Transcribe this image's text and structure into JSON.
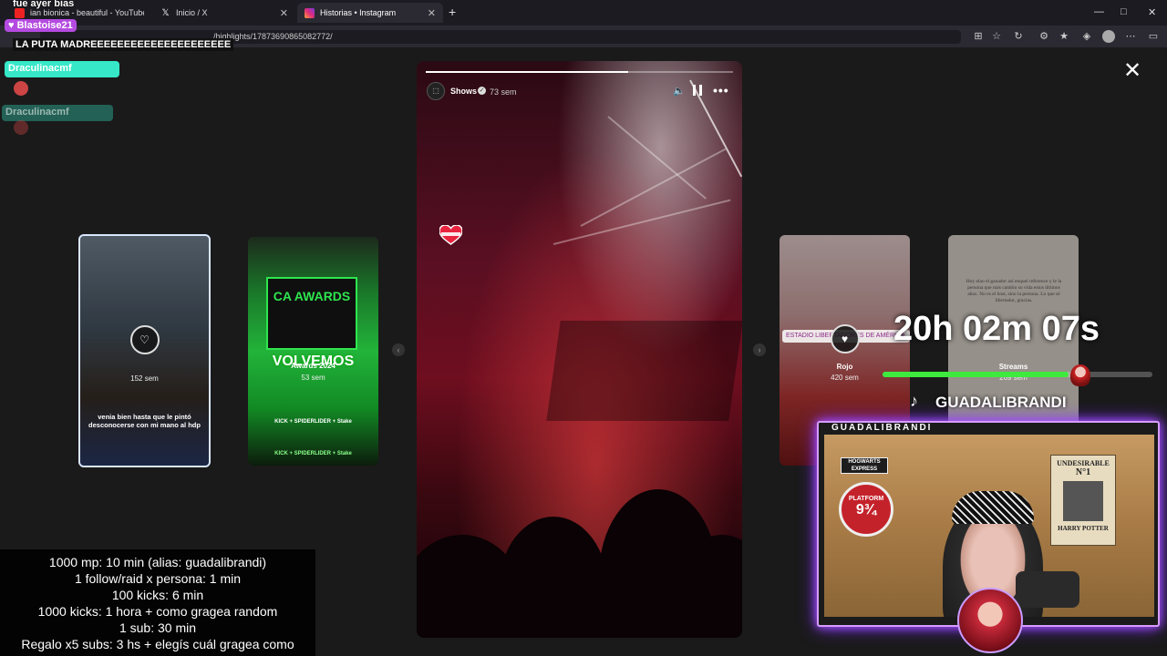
{
  "browser": {
    "tabs": [
      {
        "title": "ian bionica - beautiful - YouTube",
        "active": false,
        "icon": "youtube-icon"
      },
      {
        "title": "Inicio / X",
        "active": false,
        "icon": "x-icon"
      },
      {
        "title": "Historias • Instagram",
        "active": true,
        "icon": "instagram-icon"
      }
    ],
    "new_tab": "+",
    "window_controls": {
      "minimize": "—",
      "maximize": "□",
      "close": "✕"
    },
    "url": "/highlights/17873690865082772/",
    "toolbar_icons": [
      "apps-icon",
      "star-icon",
      "refresh-icon",
      "extensions-icon",
      "favorites-icon",
      "shield-icon",
      "profile-icon",
      "more-icon",
      "sidebar-icon"
    ]
  },
  "story": {
    "username": "Shows",
    "verified": "✓",
    "age": "73 sem",
    "progress": 0.66,
    "close": "✕",
    "controls": {
      "mute": "🔈",
      "more": "•••"
    }
  },
  "thumbnails": [
    {
      "title": "",
      "age": "152 sem",
      "caption": "venia bien hasta que le pintó desconocerse con mi mano al hdp"
    },
    {
      "title": "Awards 2024",
      "age": "53 sem",
      "logo": "CA AWARDS",
      "headline": "VOLVEMOS",
      "sponsors": "KICK + SPIDERLIDER + Stake",
      "sponsors_bottom": "KICK + SPIDERLIDER + Stake"
    },
    {
      "title": "Rojo",
      "age": "420 sem",
      "location": "ESTADIO LIBERTADORES DE AMÉRICA"
    },
    {
      "title": "Streams",
      "age": "269 sem",
      "text": "Hoy elao el ganador así enquel reference y le la persona que más cambio su vida estos últimos años. No es el host, sino la persona. Lo que sé libertador, gracias."
    }
  ],
  "nav": {
    "prev": "‹",
    "next": "›"
  },
  "overlay": {
    "chat": {
      "top_line": "fue ayer bias",
      "user1": "♥ Blastoise21",
      "msg1": "LA PUTA MADREEEEEEEEEEEEEEEEEEEEE",
      "user2": "Draculinacmf",
      "user2_faded": "Draculinacmf"
    },
    "rules": [
      "1000 mp: 10 min (alias: guadalibrandi)",
      "1 follow/raid x persona: 1 min",
      "100 kicks: 6 min",
      "1000 kicks: 1 hora + como gragea random",
      "1 sub: 30 min",
      "Regalo x5 subs: 3 hs + elegís cuál gragea como"
    ],
    "timer": "20h 02m 07s",
    "timer_progress": 0.69,
    "tiktok_handle": "GUADALIBRANDI",
    "webcam_label": "GUADALIBRANDI",
    "poster": {
      "title": "UNDESIRABLE",
      "number": "N°1",
      "name": "HARRY POTTER"
    },
    "platform_sign": {
      "line1": "PLATFORM",
      "number": "9¾"
    },
    "hogwarts_sign": "HOGWARTS EXPRESS"
  }
}
